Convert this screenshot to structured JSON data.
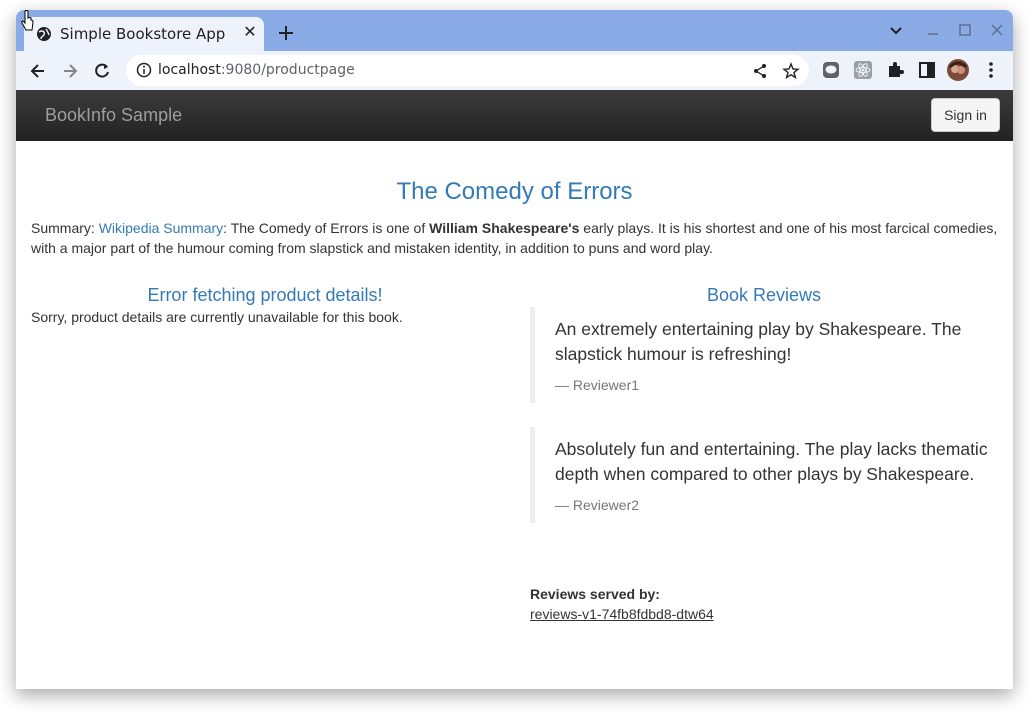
{
  "browser": {
    "tab_title": "Simple Bookstore App",
    "url_host": "localhost",
    "url_rest": ":9080/productpage"
  },
  "navbar": {
    "brand": "BookInfo Sample",
    "signin_label": "Sign in"
  },
  "book": {
    "title": "The Comedy of Errors",
    "summary_prefix": "Summary: ",
    "summary_link": "Wikipedia Summary",
    "summary_mid": ": The Comedy of Errors is one of ",
    "summary_bold": "William Shakespeare's",
    "summary_rest": " early plays. It is his shortest and one of his most farcical comedies, with a major part of the humour coming from slapstick and mistaken identity, in addition to puns and word play."
  },
  "details": {
    "heading": "Error fetching product details!",
    "message": "Sorry, product details are currently unavailable for this book."
  },
  "reviews": {
    "heading": "Book Reviews",
    "items": [
      {
        "text": "An extremely entertaining play by Shakespeare. The slapstick humour is refreshing!",
        "author": "— Reviewer1"
      },
      {
        "text": "Absolutely fun and entertaining. The play lacks thematic depth when compared to other plays by Shakespeare.",
        "author": "— Reviewer2"
      }
    ],
    "served_label": "Reviews served by:",
    "served_pod": "reviews-v1-74fb8fdbd8-dtw64"
  },
  "colors": {
    "accent": "#337ab7",
    "tabbar": "#8aabe6",
    "navbar": "#222222"
  }
}
